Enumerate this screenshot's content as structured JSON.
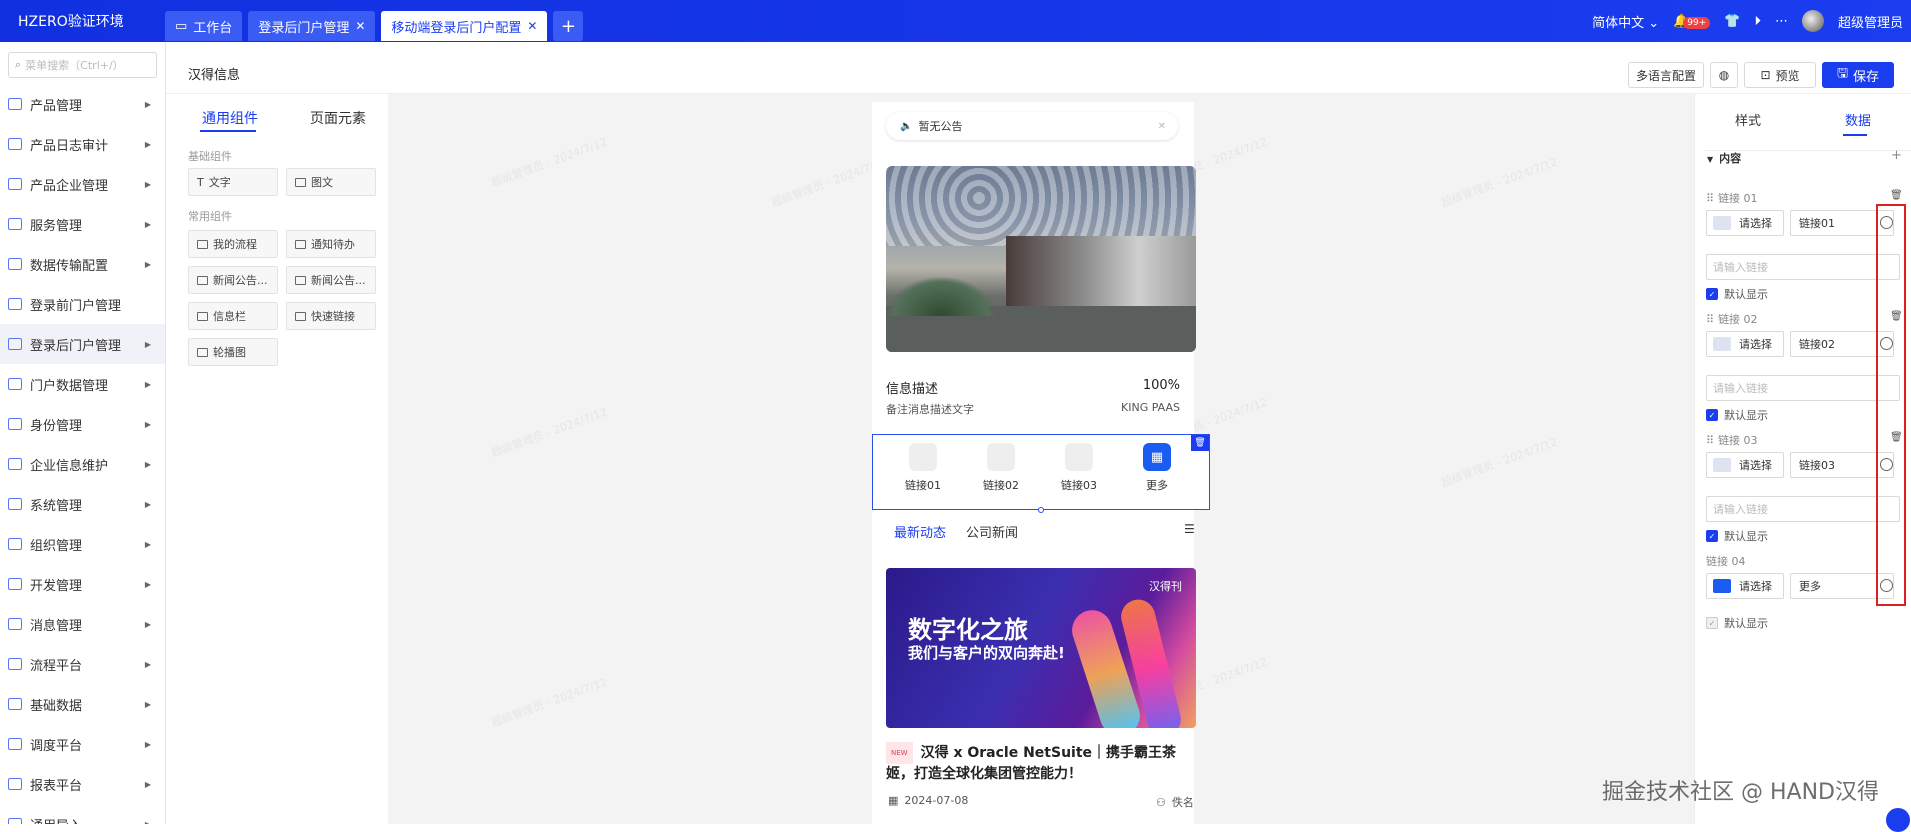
{
  "topbar": {
    "brand": "HZERO验证环境",
    "tabs": [
      {
        "label": "工作台"
      },
      {
        "label": "登录后门户管理"
      },
      {
        "label": "移动端登录后门户配置"
      }
    ],
    "tab_add": "+",
    "language": "简体中文",
    "notification_count": "99+",
    "user": "超级管理员"
  },
  "sidebar": {
    "search_placeholder": "菜单搜索（Ctrl+/）",
    "items": [
      {
        "label": "产品管理"
      },
      {
        "label": "产品日志审计"
      },
      {
        "label": "产品企业管理"
      },
      {
        "label": "服务管理"
      },
      {
        "label": "数据传输配置"
      },
      {
        "label": "登录前门户管理"
      },
      {
        "label": "登录后门户管理"
      },
      {
        "label": "门户数据管理"
      },
      {
        "label": "身份管理"
      },
      {
        "label": "企业信息维护"
      },
      {
        "label": "系统管理"
      },
      {
        "label": "组织管理"
      },
      {
        "label": "开发管理"
      },
      {
        "label": "消息管理"
      },
      {
        "label": "流程平台"
      },
      {
        "label": "基础数据"
      },
      {
        "label": "调度平台"
      },
      {
        "label": "报表平台"
      },
      {
        "label": "通用导入"
      }
    ]
  },
  "header": {
    "title": "汉得信息",
    "multilang_btn": "多语言配置",
    "preview_btn": "预览",
    "save_btn": "保存"
  },
  "components": {
    "tab_common": "通用组件",
    "tab_page": "页面元素",
    "basic_title": "基础组件",
    "basic": [
      {
        "label": "文字"
      },
      {
        "label": "图文"
      }
    ],
    "common_title": "常用组件",
    "common": [
      {
        "label": "我的流程"
      },
      {
        "label": "通知待办"
      },
      {
        "label": "新闻公告..."
      },
      {
        "label": "新闻公告..."
      },
      {
        "label": "信息栏"
      },
      {
        "label": "快速链接"
      },
      {
        "label": "轮播图"
      }
    ]
  },
  "phone": {
    "notice": "暂无公告",
    "info_title": "信息描述",
    "info_percent": "100%",
    "info_sub": "备注消息描述文字",
    "info_right": "KING PAAS",
    "links": [
      {
        "label": "链接01"
      },
      {
        "label": "链接02"
      },
      {
        "label": "链接03"
      },
      {
        "label": "更多"
      }
    ],
    "news_tabs": [
      {
        "label": "最新动态"
      },
      {
        "label": "公司新闻"
      }
    ],
    "news_banner_h1": "数字化之旅",
    "news_banner_h2": "我们与客户的双向奔赴!",
    "news_banner_logo": "汉得刊",
    "news_tag": "NEW",
    "news_title": "汉得 x Oracle NetSuite｜携手霸王茶姬，打造全球化集团管控能力！",
    "news_date": "2024-07-08",
    "news_author": "佚名"
  },
  "props": {
    "tab_style": "样式",
    "tab_data": "数据",
    "section": "内容",
    "rows": [
      {
        "label": "链接 01",
        "select": "请选择",
        "name": "链接01",
        "url_placeholder": "请输入链接",
        "default": "默认显示"
      },
      {
        "label": "链接 02",
        "select": "请选择",
        "name": "链接02",
        "url_placeholder": "请输入链接",
        "default": "默认显示"
      },
      {
        "label": "链接 03",
        "select": "请选择",
        "name": "链接03",
        "url_placeholder": "请输入链接",
        "default": "默认显示"
      },
      {
        "label": "链接 04",
        "select": "请选择",
        "name": "更多",
        "default": "默认显示"
      }
    ]
  },
  "watermark": "掘金技术社区 @ HAND汉得",
  "colors": {
    "primary": "#1a3df0",
    "highlight_border": "#e02020"
  }
}
